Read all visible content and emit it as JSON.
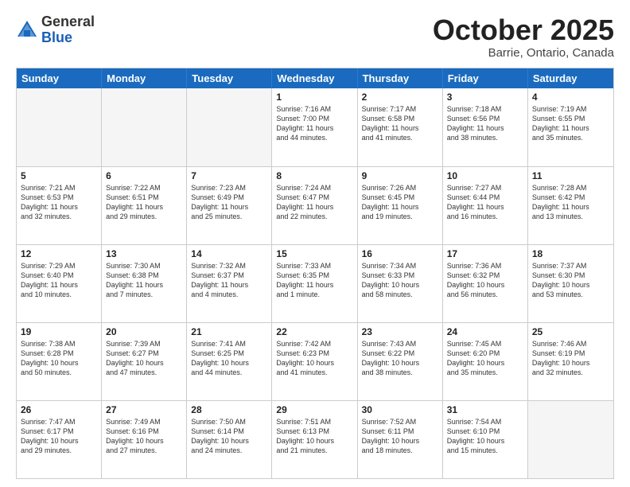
{
  "header": {
    "logo_general": "General",
    "logo_blue": "Blue",
    "month_title": "October 2025",
    "location": "Barrie, Ontario, Canada"
  },
  "day_headers": [
    "Sunday",
    "Monday",
    "Tuesday",
    "Wednesday",
    "Thursday",
    "Friday",
    "Saturday"
  ],
  "weeks": [
    [
      {
        "date": "",
        "info": ""
      },
      {
        "date": "",
        "info": ""
      },
      {
        "date": "",
        "info": ""
      },
      {
        "date": "1",
        "info": "Sunrise: 7:16 AM\nSunset: 7:00 PM\nDaylight: 11 hours\nand 44 minutes."
      },
      {
        "date": "2",
        "info": "Sunrise: 7:17 AM\nSunset: 6:58 PM\nDaylight: 11 hours\nand 41 minutes."
      },
      {
        "date": "3",
        "info": "Sunrise: 7:18 AM\nSunset: 6:56 PM\nDaylight: 11 hours\nand 38 minutes."
      },
      {
        "date": "4",
        "info": "Sunrise: 7:19 AM\nSunset: 6:55 PM\nDaylight: 11 hours\nand 35 minutes."
      }
    ],
    [
      {
        "date": "5",
        "info": "Sunrise: 7:21 AM\nSunset: 6:53 PM\nDaylight: 11 hours\nand 32 minutes."
      },
      {
        "date": "6",
        "info": "Sunrise: 7:22 AM\nSunset: 6:51 PM\nDaylight: 11 hours\nand 29 minutes."
      },
      {
        "date": "7",
        "info": "Sunrise: 7:23 AM\nSunset: 6:49 PM\nDaylight: 11 hours\nand 25 minutes."
      },
      {
        "date": "8",
        "info": "Sunrise: 7:24 AM\nSunset: 6:47 PM\nDaylight: 11 hours\nand 22 minutes."
      },
      {
        "date": "9",
        "info": "Sunrise: 7:26 AM\nSunset: 6:45 PM\nDaylight: 11 hours\nand 19 minutes."
      },
      {
        "date": "10",
        "info": "Sunrise: 7:27 AM\nSunset: 6:44 PM\nDaylight: 11 hours\nand 16 minutes."
      },
      {
        "date": "11",
        "info": "Sunrise: 7:28 AM\nSunset: 6:42 PM\nDaylight: 11 hours\nand 13 minutes."
      }
    ],
    [
      {
        "date": "12",
        "info": "Sunrise: 7:29 AM\nSunset: 6:40 PM\nDaylight: 11 hours\nand 10 minutes."
      },
      {
        "date": "13",
        "info": "Sunrise: 7:30 AM\nSunset: 6:38 PM\nDaylight: 11 hours\nand 7 minutes."
      },
      {
        "date": "14",
        "info": "Sunrise: 7:32 AM\nSunset: 6:37 PM\nDaylight: 11 hours\nand 4 minutes."
      },
      {
        "date": "15",
        "info": "Sunrise: 7:33 AM\nSunset: 6:35 PM\nDaylight: 11 hours\nand 1 minute."
      },
      {
        "date": "16",
        "info": "Sunrise: 7:34 AM\nSunset: 6:33 PM\nDaylight: 10 hours\nand 58 minutes."
      },
      {
        "date": "17",
        "info": "Sunrise: 7:36 AM\nSunset: 6:32 PM\nDaylight: 10 hours\nand 56 minutes."
      },
      {
        "date": "18",
        "info": "Sunrise: 7:37 AM\nSunset: 6:30 PM\nDaylight: 10 hours\nand 53 minutes."
      }
    ],
    [
      {
        "date": "19",
        "info": "Sunrise: 7:38 AM\nSunset: 6:28 PM\nDaylight: 10 hours\nand 50 minutes."
      },
      {
        "date": "20",
        "info": "Sunrise: 7:39 AM\nSunset: 6:27 PM\nDaylight: 10 hours\nand 47 minutes."
      },
      {
        "date": "21",
        "info": "Sunrise: 7:41 AM\nSunset: 6:25 PM\nDaylight: 10 hours\nand 44 minutes."
      },
      {
        "date": "22",
        "info": "Sunrise: 7:42 AM\nSunset: 6:23 PM\nDaylight: 10 hours\nand 41 minutes."
      },
      {
        "date": "23",
        "info": "Sunrise: 7:43 AM\nSunset: 6:22 PM\nDaylight: 10 hours\nand 38 minutes."
      },
      {
        "date": "24",
        "info": "Sunrise: 7:45 AM\nSunset: 6:20 PM\nDaylight: 10 hours\nand 35 minutes."
      },
      {
        "date": "25",
        "info": "Sunrise: 7:46 AM\nSunset: 6:19 PM\nDaylight: 10 hours\nand 32 minutes."
      }
    ],
    [
      {
        "date": "26",
        "info": "Sunrise: 7:47 AM\nSunset: 6:17 PM\nDaylight: 10 hours\nand 29 minutes."
      },
      {
        "date": "27",
        "info": "Sunrise: 7:49 AM\nSunset: 6:16 PM\nDaylight: 10 hours\nand 27 minutes."
      },
      {
        "date": "28",
        "info": "Sunrise: 7:50 AM\nSunset: 6:14 PM\nDaylight: 10 hours\nand 24 minutes."
      },
      {
        "date": "29",
        "info": "Sunrise: 7:51 AM\nSunset: 6:13 PM\nDaylight: 10 hours\nand 21 minutes."
      },
      {
        "date": "30",
        "info": "Sunrise: 7:52 AM\nSunset: 6:11 PM\nDaylight: 10 hours\nand 18 minutes."
      },
      {
        "date": "31",
        "info": "Sunrise: 7:54 AM\nSunset: 6:10 PM\nDaylight: 10 hours\nand 15 minutes."
      },
      {
        "date": "",
        "info": ""
      }
    ]
  ]
}
